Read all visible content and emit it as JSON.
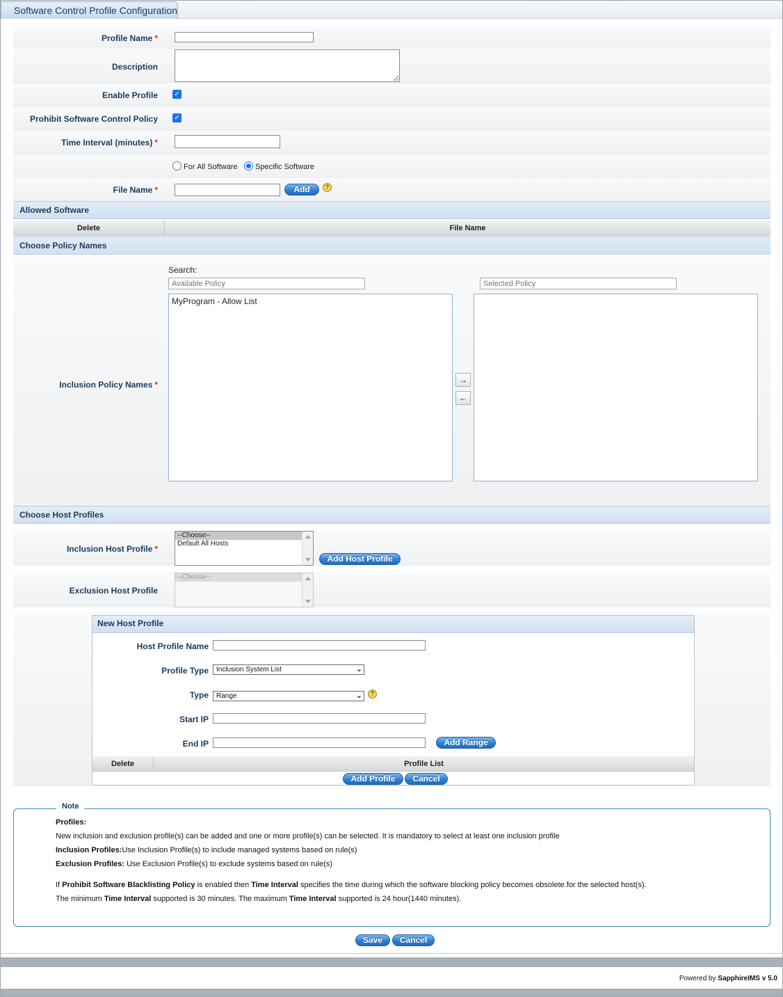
{
  "window": {
    "title": "Software Control Profile Configuration"
  },
  "form": {
    "profile_name_label": "Profile Name",
    "description_label": "Description",
    "enable_profile_label": "Enable Profile",
    "prohibit_label": "Prohibit Software Control Policy",
    "time_interval_label": "Time Interval (minutes)",
    "radio_all_label": "For All Software",
    "radio_specific_label": "Specific Software",
    "file_name_label": "File Name",
    "add_label": "Add",
    "required_mark": "*",
    "help_glyph": "?",
    "enable_profile_checked": true,
    "prohibit_checked": true,
    "selected_scope": "Specific Software"
  },
  "allowed_software": {
    "section_title": "Allowed Software",
    "col_delete": "Delete",
    "col_file_name": "File Name"
  },
  "policy": {
    "section_title": "Choose Policy Names",
    "search_label": "Search:",
    "available_placeholder": "Available Policy",
    "selected_placeholder": "Selected Policy",
    "inclusion_label": "Inclusion Policy Names",
    "available_items": [
      "MyProgram - Allow List"
    ],
    "move_right_glyph": "→",
    "move_left_glyph": "←"
  },
  "host_profiles": {
    "section_title": "Choose Host Profiles",
    "inclusion_label": "Inclusion Host Profile",
    "inclusion_options": [
      "--Choose--",
      "Default All Hosts"
    ],
    "add_host_profile_label": "Add Host Profile",
    "exclusion_label": "Exclusion Host Profile",
    "exclusion_options": [
      "--Choose--"
    ]
  },
  "new_host_profile": {
    "panel_title": "New Host Profile",
    "host_profile_name_label": "Host Profile Name",
    "profile_type_label": "Profile Type",
    "profile_type_value": "Inclusion System List",
    "type_label": "Type",
    "type_value": "Range",
    "start_ip_label": "Start IP",
    "end_ip_label": "End IP",
    "add_range_label": "Add Range",
    "col_delete": "Delete",
    "col_profile_list": "Profile List",
    "add_profile_label": "Add Profile",
    "cancel_label": "Cancel"
  },
  "note": {
    "legend": "Note",
    "profiles_heading": "Profiles:",
    "line1": "New inclusion and exclusion profile(s) can be added and one or more profile(s) can be selected. It is mandatory to select at least one inclusion profile",
    "inclusion_bold": "Inclusion Profiles:",
    "inclusion_text": "Use Inclusion Profile(s) to include managed systems based on rule(s)",
    "exclusion_bold": "Exclusion Profiles:",
    "exclusion_text": " Use Exclusion Profile(s) to exclude systems based on rule(s)",
    "p1_a": "If ",
    "p1_b": "Prohibit Software Blacklisting Policy",
    "p1_c": " is enabled then ",
    "p1_d": "Time Interval",
    "p1_e": " specifies the time during which the software blocking policy becomes obsolete.for the selected host(s).",
    "p2_a": "The minimum ",
    "p2_b": "Time Interval",
    "p2_c": " supported is 30 minutes. The maximum ",
    "p2_d": "Time Interval",
    "p2_e": " supported is 24 hour(1440 minutes)."
  },
  "actions": {
    "save_label": "Save",
    "cancel_label": "Cancel"
  },
  "footer": {
    "powered_by": "Powered by ",
    "brand": "SapphireIMS v 5.0"
  }
}
